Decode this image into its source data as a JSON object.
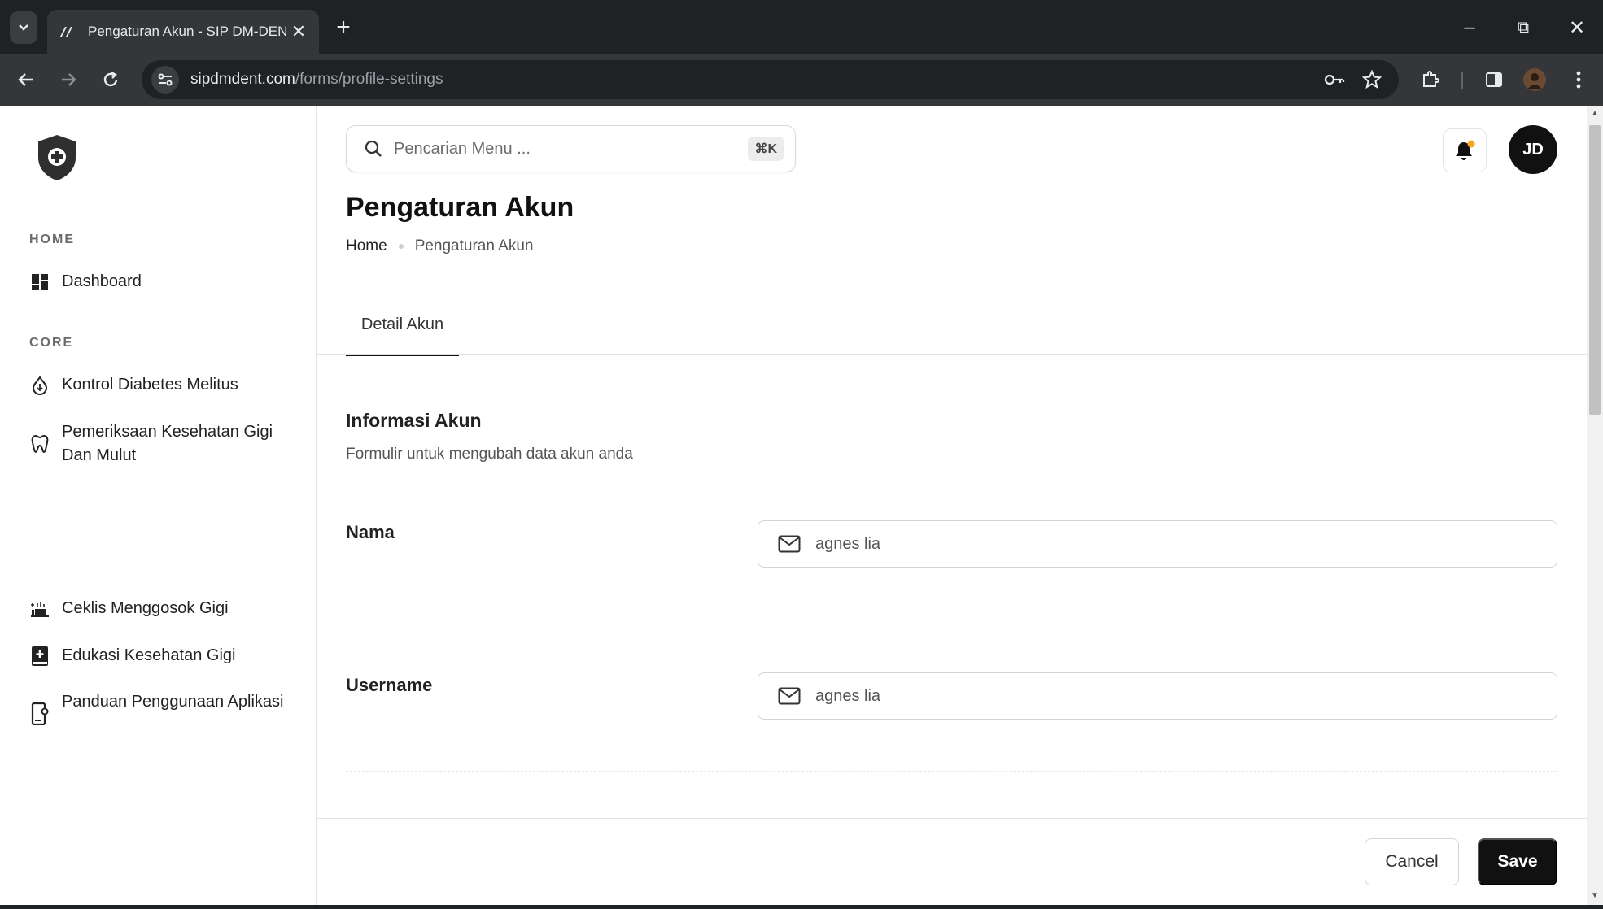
{
  "browser": {
    "tab_title": "Pengaturan Akun - SIP DM-DEN",
    "url_host": "sipdmdent.com",
    "url_path": "/forms/profile-settings",
    "minimize": "–",
    "restore": "⧉",
    "close": "✕",
    "new_tab": "+"
  },
  "sidebar": {
    "sections": [
      {
        "label": "HOME",
        "items": [
          {
            "label": "Dashboard",
            "icon": "dashboard-icon"
          }
        ]
      },
      {
        "label": "CORE",
        "items": [
          {
            "label": "Kontrol Diabetes Melitus",
            "icon": "blood-drop-icon"
          },
          {
            "label": "Pemeriksaan Kesehatan Gigi Dan Mulut",
            "icon": "tooth-icon"
          },
          {
            "label": "Ceklis Menggosok Gigi",
            "icon": "checklist-icon"
          },
          {
            "label": "Edukasi Kesehatan Gigi",
            "icon": "medical-book-icon"
          },
          {
            "label": "Panduan Penggunaan Aplikasi",
            "icon": "phone-guide-icon"
          }
        ]
      }
    ]
  },
  "header": {
    "search_placeholder": "Pencarian Menu ...",
    "search_shortcut": "⌘K",
    "avatar_initials": "JD",
    "notification_dot_color": "#f5a623"
  },
  "page": {
    "title": "Pengaturan Akun",
    "breadcrumb": [
      "Home",
      "Pengaturan Akun"
    ],
    "tabs": [
      {
        "label": "Detail Akun",
        "active": true
      }
    ],
    "section_title": "Informasi Akun",
    "section_subtitle": "Formulir untuk mengubah data akun anda",
    "fields": [
      {
        "label": "Nama",
        "value": "agnes lia",
        "icon": "mail-icon"
      },
      {
        "label": "Username",
        "value": "agnes lia",
        "icon": "mail-icon"
      }
    ]
  },
  "actions": {
    "cancel": "Cancel",
    "save": "Save"
  }
}
